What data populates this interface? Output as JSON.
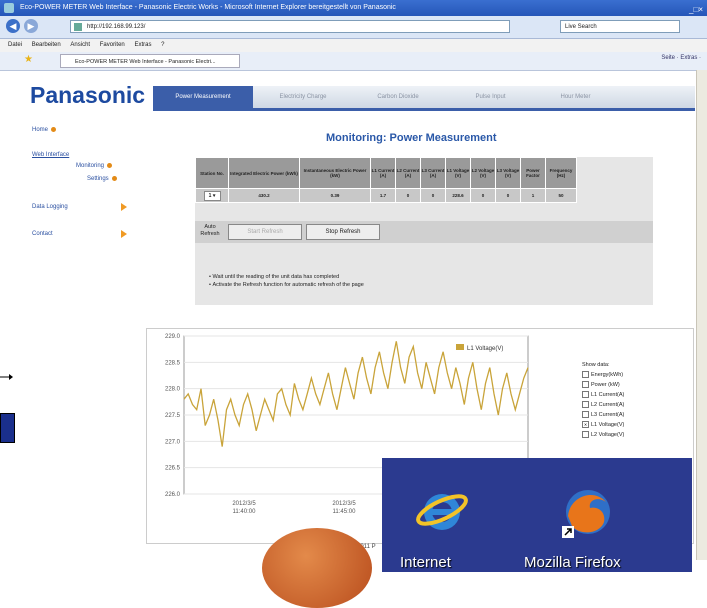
{
  "window": {
    "title": "Eco-POWER METER Web Interface - Panasonic Electric Works - Microsoft Internet Explorer bereitgestellt von Panasonic",
    "controls": "_□×"
  },
  "addressbar": {
    "url": "http://192.168.99.123/",
    "search_placeholder": "Live Search"
  },
  "menubar": {
    "items": [
      "Datei",
      "Bearbeiten",
      "Ansicht",
      "Favoriten",
      "Extras",
      "?"
    ]
  },
  "browser_tab": {
    "label": "Eco-POWER METER Web Interface - Panasonic Electri...",
    "tools": "Seite · Extras ·"
  },
  "brand": {
    "logo": "Panasonic",
    "color": "#1d4aa0",
    "accent": "#3b5ea9"
  },
  "nav_tabs": [
    "Power Measurement",
    "Electricity Charge",
    "Carbon Dioxide",
    "Pulse Input",
    "Hour Meter"
  ],
  "sidebar": {
    "home": "Home",
    "web_interface": "Web Interface",
    "monitoring": "Monitoring",
    "settings": "Settings",
    "data_logging": "Data Logging",
    "contact": "Contact"
  },
  "page": {
    "heading": "Monitoring: Power Measurement"
  },
  "table": {
    "headers": [
      "Station No.",
      "Integrated Electric Power (kWh)",
      "Instantaneous Electric Power (kW)",
      "L1 Current (A)",
      "L2 Current (A)",
      "L3 Current (A)",
      "L1 Voltage (V)",
      "L2 Voltage (V)",
      "L3 Voltage (V)",
      "Power Factor",
      "Frequency (Hz)"
    ],
    "station": "1",
    "row": [
      "430.2",
      "0.39",
      "1.7",
      "0",
      "0",
      "228.6",
      "0",
      "0",
      "1",
      "50"
    ]
  },
  "refresh": {
    "label": "Auto Refresh",
    "start": "Start Refresh",
    "stop": "Stop Refresh"
  },
  "notes": [
    "Wait until the reading of the unit data has completed",
    "Activate the Refresh function for automatic refresh of the page"
  ],
  "chart_data": {
    "type": "line",
    "series": [
      {
        "name": "L1 Voltage(V)",
        "color": "#c9a43a",
        "values": [
          227.8,
          227.9,
          227.7,
          227.6,
          228.0,
          227.3,
          227.5,
          227.8,
          227.4,
          226.9,
          227.6,
          227.8,
          227.5,
          227.3,
          227.7,
          227.9,
          227.6,
          227.2,
          227.5,
          227.8,
          227.6,
          227.4,
          227.9,
          228.0,
          227.7,
          227.5,
          228.1,
          227.8,
          227.6,
          227.9,
          228.2,
          227.9,
          227.7,
          228.0,
          228.3,
          227.9,
          227.6,
          228.0,
          228.4,
          228.1,
          227.8,
          228.3,
          228.6,
          228.2,
          227.9,
          228.4,
          228.7,
          228.3,
          228.0,
          228.5,
          228.9,
          228.4,
          228.1,
          228.6,
          228.8,
          228.3,
          228.0,
          228.5,
          228.2,
          227.9,
          228.4,
          228.7,
          228.3,
          228.0,
          228.4,
          228.1,
          227.7,
          228.2,
          228.5,
          228.0,
          227.6,
          228.1,
          228.4,
          227.9,
          227.5,
          228.0,
          228.3,
          227.9,
          227.6,
          227.9,
          228.2,
          228.4
        ]
      }
    ],
    "ylim": [
      226.0,
      229.0
    ],
    "yticks": [
      "229.0",
      "228.5",
      "228.0",
      "227.5",
      "227.0",
      "226.5",
      "226.0"
    ],
    "xticks": [
      {
        "date": "2012/3/5",
        "time": "11:40:00"
      },
      {
        "date": "2012/3/5",
        "time": "11:45:00"
      }
    ],
    "legend_position": "top-right",
    "show_data_title": "Show data:",
    "show_data_options": [
      {
        "label": "Energy(kWh)",
        "checked": false
      },
      {
        "label": "Power (kW)",
        "checked": false
      },
      {
        "label": "L1 Current(A)",
        "checked": false
      },
      {
        "label": "L2 Current(A)",
        "checked": false
      },
      {
        "label": "L3 Current(A)",
        "checked": false
      },
      {
        "label": "L1 Voltage(V)",
        "checked": true
      },
      {
        "label": "L2 Voltage(V)",
        "checked": false
      }
    ]
  },
  "footer": "2011 P",
  "desktop": {
    "ie_label": "Internet",
    "firefox_label": "Mozilla Firefox"
  }
}
